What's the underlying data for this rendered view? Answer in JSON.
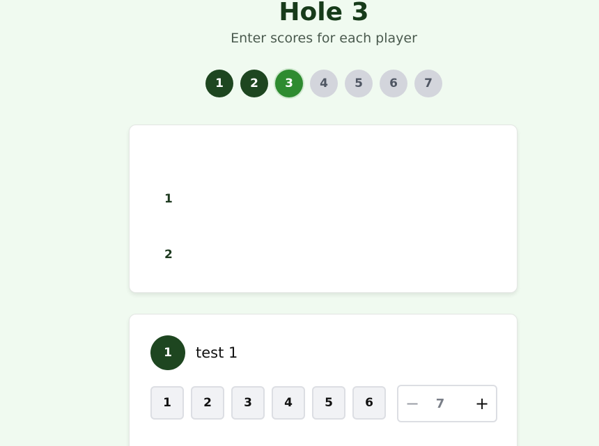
{
  "header": {
    "title": "Hole 3",
    "subtitle": "Enter scores for each player"
  },
  "holes": [
    {
      "label": "1",
      "state": "done"
    },
    {
      "label": "2",
      "state": "done"
    },
    {
      "label": "3",
      "state": "current"
    },
    {
      "label": "4",
      "state": "pending"
    },
    {
      "label": "5",
      "state": "pending"
    },
    {
      "label": "6",
      "state": "pending"
    },
    {
      "label": "7",
      "state": "pending"
    }
  ],
  "summary": {
    "rows": [
      "1",
      "2"
    ]
  },
  "player": {
    "number": "1",
    "name": "test 1",
    "quick_scores": [
      "1",
      "2",
      "3",
      "4",
      "5",
      "6"
    ],
    "score_value": "7",
    "minus_symbol": "−",
    "plus_symbol": "+"
  },
  "colors": {
    "background": "#f0faf0",
    "dark_green": "#1e4620",
    "current_green": "#2e8b30",
    "pending_gray": "#d3d5dc"
  }
}
